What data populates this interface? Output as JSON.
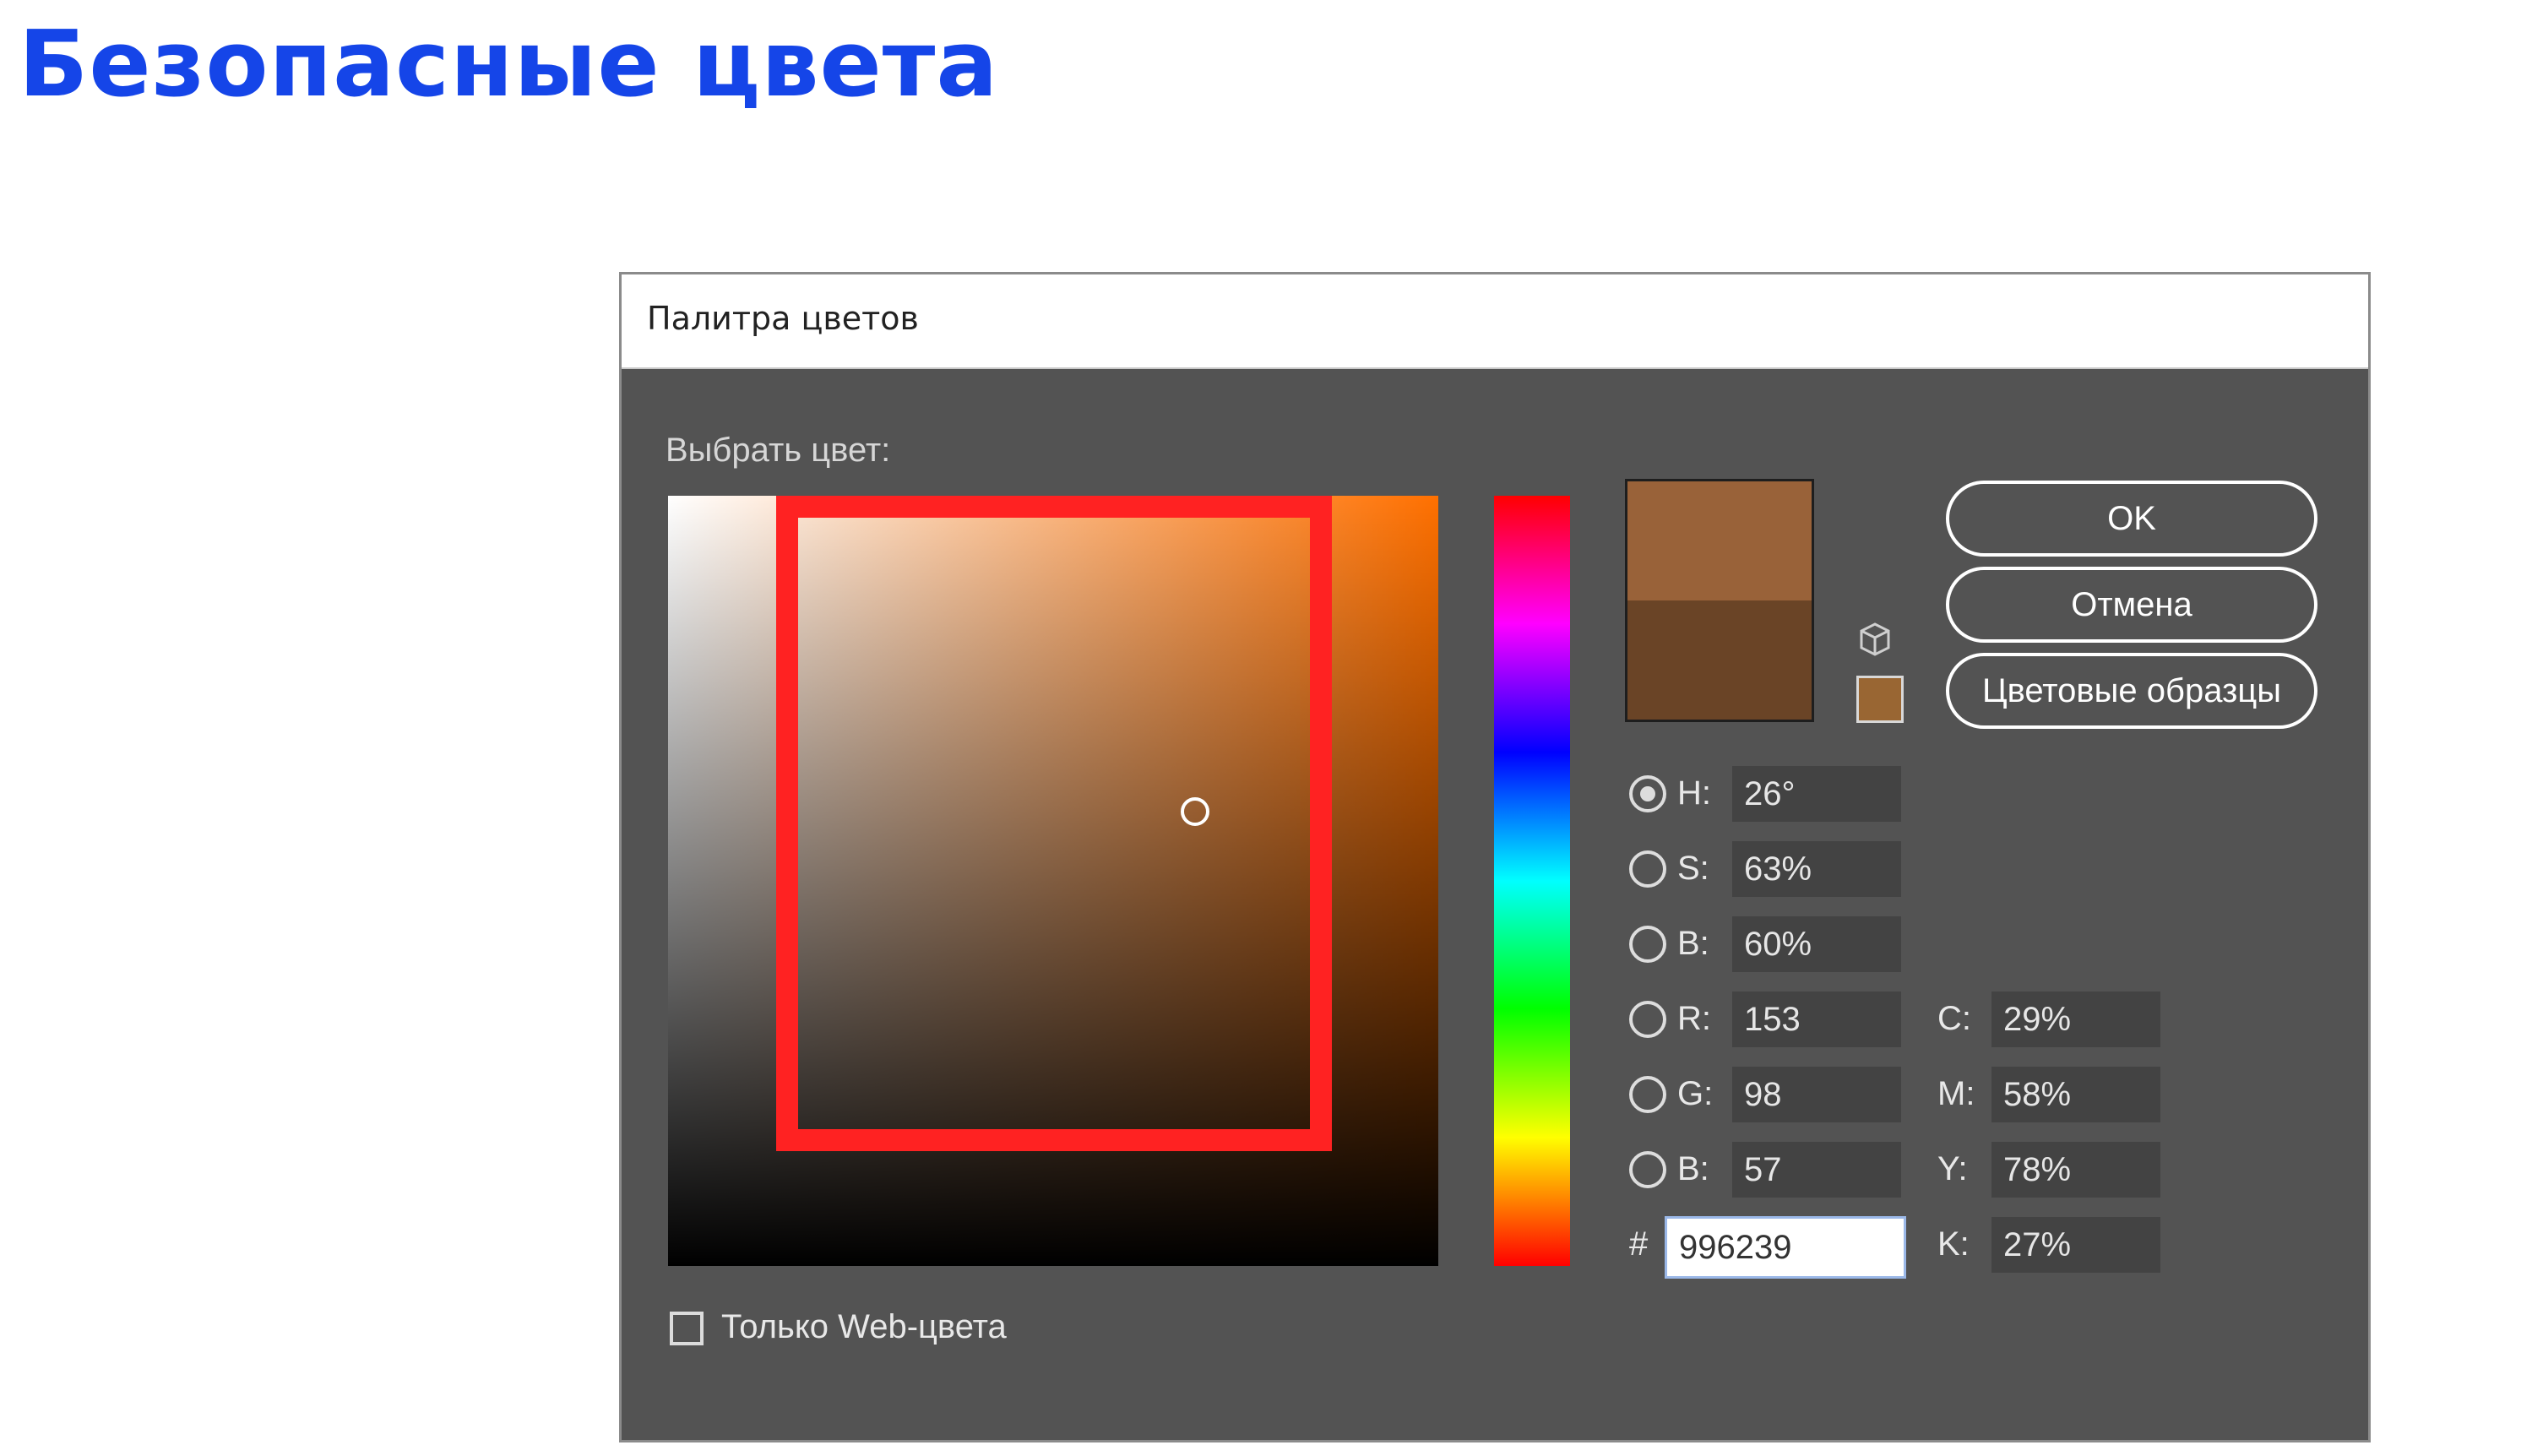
{
  "slide": {
    "title": "Безопасные цвета"
  },
  "dialog": {
    "title": "Палитра цветов",
    "pick_label": "Выбрать цвет:",
    "buttons": {
      "ok": "OK",
      "cancel": "Отмена",
      "swatches": "Цветовые образцы"
    },
    "colors": {
      "new_color": "#996239",
      "old_color": "#6a4426",
      "websafe_color": "#996633",
      "highlight": "#ff2222"
    },
    "hsb": [
      {
        "label": "H:",
        "value": "26°",
        "checked": true
      },
      {
        "label": "S:",
        "value": "63%",
        "checked": false
      },
      {
        "label": "B:",
        "value": "60%",
        "checked": false
      }
    ],
    "rgb": [
      {
        "label": "R:",
        "value": "153",
        "checked": false
      },
      {
        "label": "G:",
        "value": "98",
        "checked": false
      },
      {
        "label": "B:",
        "value": "57",
        "checked": false
      }
    ],
    "hex": {
      "label": "#",
      "value": "996239"
    },
    "cmyk": [
      {
        "label": "C:",
        "value": "29%"
      },
      {
        "label": "M:",
        "value": "58%"
      },
      {
        "label": "Y:",
        "value": "78%"
      },
      {
        "label": "K:",
        "value": "27%"
      }
    ],
    "web_only": {
      "label": "Только Web-цвета",
      "checked": false
    }
  }
}
